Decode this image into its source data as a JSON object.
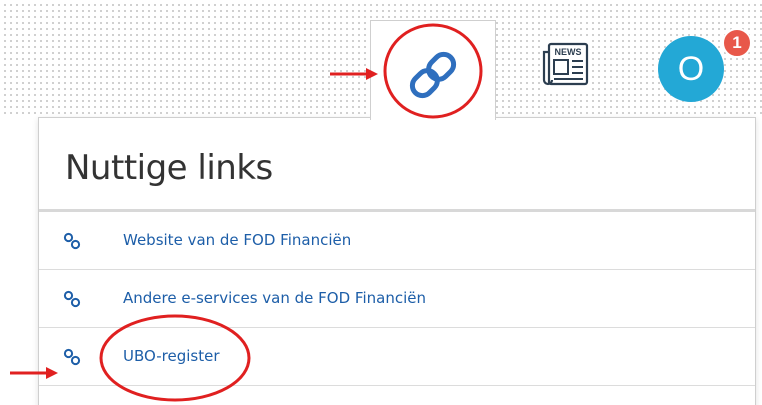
{
  "header": {
    "tabs": [
      {
        "name": "useful-links",
        "icon": "link-icon"
      },
      {
        "name": "news",
        "icon": "newspaper-icon",
        "label": "NEWS"
      }
    ],
    "avatar_initial": "O",
    "notification_count": "1",
    "colors": {
      "link_icon": "#2f6fbe",
      "avatar": "#23a8d6",
      "badge": "#e8584a",
      "annotation": "#e02020"
    }
  },
  "panel": {
    "title": "Nuttige links",
    "items": [
      {
        "label": "Website van de FOD Financiën",
        "icon": "link-icon"
      },
      {
        "label": "Andere e-services van de FOD Financiën",
        "icon": "link-icon"
      },
      {
        "label": "UBO-register",
        "icon": "link-icon"
      }
    ]
  }
}
